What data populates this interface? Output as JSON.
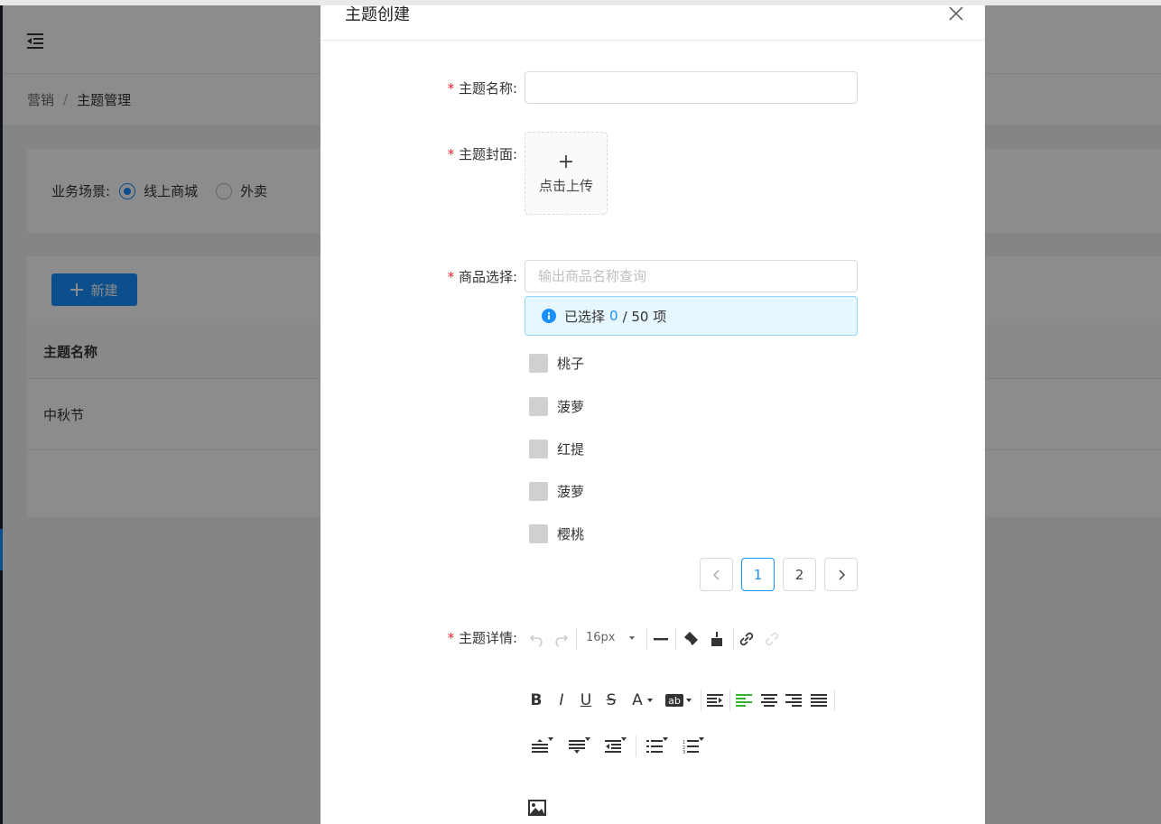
{
  "background": {
    "breadcrumb": {
      "root": "营销",
      "separator": "/",
      "current": "主题管理"
    },
    "filter": {
      "label": "业务场景:",
      "options": [
        "线上商城",
        "外卖"
      ],
      "selected": "线上商城"
    },
    "new_button_label": "新建",
    "table": {
      "column_header": "主题名称",
      "rows": [
        "中秋节"
      ]
    }
  },
  "modal": {
    "title": "主题创建",
    "fields": {
      "name_label": "主题名称:",
      "cover_label": "主题封面:",
      "upload_text": "点击上传",
      "goods_label": "商品选择:",
      "search_placeholder": "输出商品名称查询",
      "detail_label": "主题详情:"
    },
    "selection_alert": {
      "prefix": "已选择",
      "count": "0",
      "suffix": "/ 50 项"
    },
    "goods": [
      "桃子",
      "菠萝",
      "红提",
      "菠萝",
      "樱桃"
    ],
    "pagination": {
      "pages": [
        "1",
        "2"
      ],
      "current": "1"
    },
    "editor": {
      "font_size": "16px"
    }
  },
  "colors": {
    "accent": "#1890ff",
    "required": "#f5222d",
    "align_left_active": "#2db52d"
  }
}
